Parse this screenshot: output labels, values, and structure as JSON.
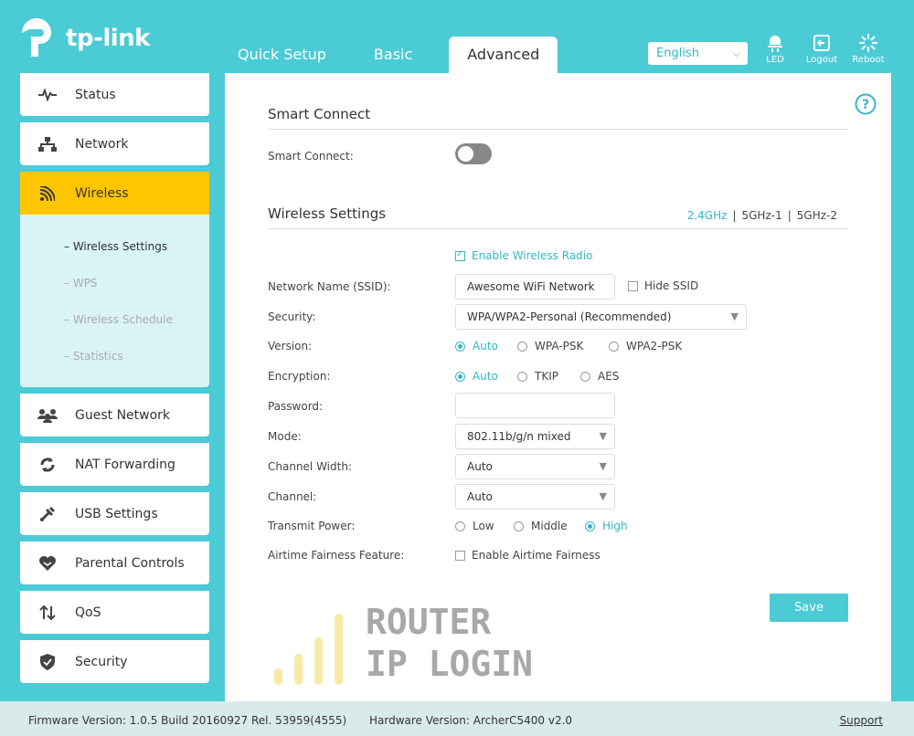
{
  "header": {
    "logo_text": "tp-link",
    "tabs": [
      {
        "label": "Quick Setup"
      },
      {
        "label": "Basic"
      },
      {
        "label": "Advanced"
      }
    ],
    "language": "English",
    "led_label": "LED",
    "logout_label": "Logout",
    "reboot_label": "Reboot"
  },
  "sidebar": {
    "items": [
      {
        "label": "Status",
        "icon": "pulse-icon"
      },
      {
        "label": "Network",
        "icon": "network-tree-icon"
      },
      {
        "label": "Wireless",
        "icon": "wifi-icon"
      },
      {
        "label": "Guest Network",
        "icon": "guests-icon"
      },
      {
        "label": "NAT Forwarding",
        "icon": "refresh-arrows-icon"
      },
      {
        "label": "USB Settings",
        "icon": "usb-icon"
      },
      {
        "label": "Parental Controls",
        "icon": "heart-icon"
      },
      {
        "label": "QoS",
        "icon": "sort-arrows-icon"
      },
      {
        "label": "Security",
        "icon": "shield-icon"
      }
    ],
    "wireless_sub": [
      {
        "label": "Wireless Settings"
      },
      {
        "label": "WPS"
      },
      {
        "label": "Wireless Schedule"
      },
      {
        "label": "Statistics"
      }
    ]
  },
  "smart_connect": {
    "title": "Smart Connect",
    "label": "Smart Connect:",
    "enabled": false
  },
  "wireless": {
    "title": "Wireless Settings",
    "bands": [
      "2.4GHz",
      "5GHz-1",
      "5GHz-2"
    ],
    "active_band": "2.4GHz",
    "enable_radio_label": "Enable Wireless Radio",
    "ssid_label": "Network Name (SSID):",
    "ssid_value": "Awesome WiFi Network",
    "hide_ssid_label": "Hide SSID",
    "security_label": "Security:",
    "security_value": "WPA/WPA2-Personal (Recommended)",
    "version_label": "Version:",
    "version_options": [
      "Auto",
      "WPA-PSK",
      "WPA2-PSK"
    ],
    "encryption_label": "Encryption:",
    "encryption_options": [
      "Auto",
      "TKIP",
      "AES"
    ],
    "password_label": "Password:",
    "password_value": "",
    "mode_label": "Mode:",
    "mode_value": "802.11b/g/n mixed",
    "channel_width_label": "Channel Width:",
    "channel_width_value": "Auto",
    "channel_label": "Channel:",
    "channel_value": "Auto",
    "transmit_label": "Transmit Power:",
    "transmit_options": [
      "Low",
      "Middle",
      "High"
    ],
    "airtime_label": "Airtime Fairness Feature:",
    "airtime_check_label": "Enable Airtime Fairness",
    "save_label": "Save"
  },
  "watermark": {
    "line1": "ROUTER",
    "line2": "IP LOGIN"
  },
  "footer": {
    "firmware": "Firmware Version: 1.0.5 Build 20160927 Rel. 53959(4555)",
    "hardware": "Hardware Version: ArcherC5400 v2.0",
    "support": "Support"
  },
  "colors": {
    "brand": "#4acbd6",
    "accent": "#33b7c7",
    "active_nav": "#ffc600"
  }
}
